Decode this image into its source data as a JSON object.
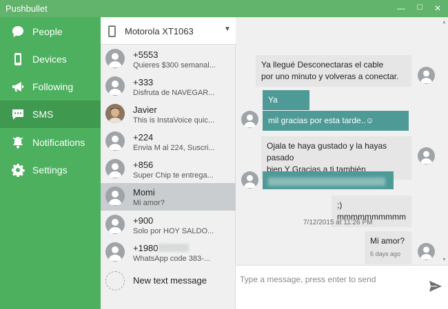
{
  "window": {
    "title": "Pushbullet",
    "controls": [
      "—",
      "☐",
      "✕"
    ]
  },
  "sidebar": {
    "items": [
      {
        "label": "People",
        "icon": "people-chat-icon",
        "active": false
      },
      {
        "label": "Devices",
        "icon": "phone-icon",
        "active": false
      },
      {
        "label": "Following",
        "icon": "megaphone-icon",
        "active": false
      },
      {
        "label": "SMS",
        "icon": "sms-icon",
        "active": true
      },
      {
        "label": "Notifications",
        "icon": "bell-icon",
        "active": false
      },
      {
        "label": "Settings",
        "icon": "gear-icon",
        "active": false
      }
    ]
  },
  "device": {
    "name": "Motorola XT1063",
    "icon": "phone-icon"
  },
  "conversations": [
    {
      "name": "+5553",
      "preview": "Quieres $300 semanal..."
    },
    {
      "name": "+333",
      "preview": "Disfruta de NAVEGAR..."
    },
    {
      "name": "Javier",
      "preview": "This is InstaVoice quic..."
    },
    {
      "name": "+224",
      "preview": "Envia M al 224, Suscri..."
    },
    {
      "name": "+856",
      "preview": "Super Chip te entrega..."
    },
    {
      "name": "Momi",
      "preview": "Mi amor?",
      "active": true
    },
    {
      "name": "+900",
      "preview": "Solo por HOY SALDO..."
    },
    {
      "name": "+1980",
      "preview": "WhatsApp code 383-..."
    }
  ],
  "new_message": {
    "label": "New text message"
  },
  "messages": [
    {
      "direction": "in",
      "lines": [
        "Ya llegué Desconectaras el cable",
        "por uno minuto y volveras a conectar."
      ]
    },
    {
      "direction": "out",
      "lines": [
        "Ya"
      ]
    },
    {
      "direction": "out",
      "lines": [
        "mil gracias por esta tarde..☺"
      ]
    },
    {
      "direction": "in",
      "lines": [
        "Ojala te haya gustado y la hayas pasado",
        "bien  Y Gracias a ti también"
      ]
    },
    {
      "direction": "out",
      "lines": [
        ""
      ],
      "redacted": true
    },
    {
      "direction": "in",
      "lines": [
        ";) mmmmmmmmmm"
      ]
    },
    {
      "direction": "in",
      "lines": [
        "Mi amor?"
      ],
      "sub": "6 days ago"
    }
  ],
  "timestamp": "7/12/2015 at 11:26 PM",
  "composer": {
    "placeholder": "Type a message, press enter to send",
    "send_icon": "send-icon"
  },
  "colors": {
    "sidebar": "#4cb05e",
    "titlebar": "#62b36b",
    "outgoing": "#4e9a97",
    "incoming": "#e6e6e6"
  }
}
